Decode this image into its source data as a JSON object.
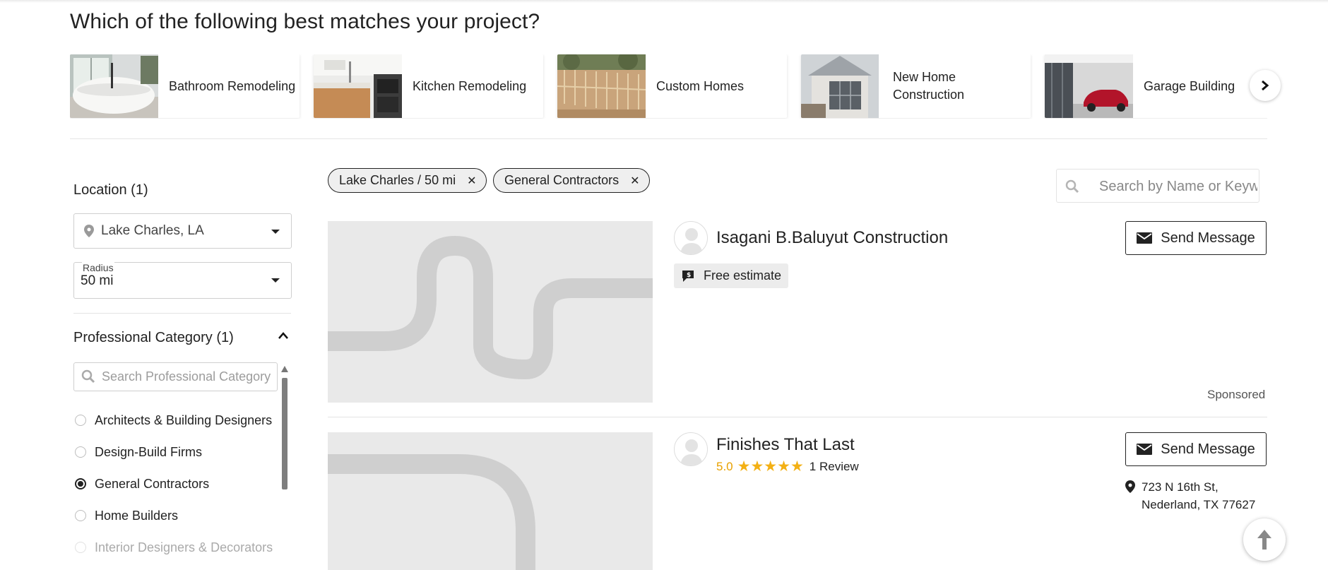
{
  "heading": "Which of the following best matches your project?",
  "categories": [
    {
      "label": "Bathroom Remodeling",
      "icon": "bathroom-photo"
    },
    {
      "label": "Kitchen Remodeling",
      "icon": "kitchen-photo"
    },
    {
      "label": "Custom Homes",
      "icon": "custom-homes-photo"
    },
    {
      "label": "New Home Construction",
      "icon": "new-home-photo"
    },
    {
      "label": "Garage Building",
      "icon": "garage-photo"
    }
  ],
  "filters": {
    "location_title": "Location (1)",
    "location_value": "Lake Charles, LA",
    "radius_label": "Radius",
    "radius_value": "50 mi",
    "category_title": "Professional Category (1)",
    "category_search_placeholder": "Search Professional Category",
    "options": [
      {
        "label": "Architects & Building Designers",
        "selected": false
      },
      {
        "label": "Design-Build Firms",
        "selected": false
      },
      {
        "label": "General Contractors",
        "selected": true
      },
      {
        "label": "Home Builders",
        "selected": false
      },
      {
        "label": "Interior Designers & Decorators",
        "selected": false
      }
    ]
  },
  "chips": [
    {
      "label": "Lake Charles / 50 mi"
    },
    {
      "label": "General Contractors"
    }
  ],
  "search": {
    "placeholder": "Search by Name or Keyword"
  },
  "results": [
    {
      "name": "Isagani B.Baluyut Construction",
      "badge": "Free estimate",
      "send_label": "Send Message",
      "sponsored": "Sponsored"
    },
    {
      "name": "Finishes That Last",
      "rating": "5.0",
      "stars": 5,
      "reviews": "1 Review",
      "send_label": "Send Message",
      "address_line1": "723 N 16th St,",
      "address_line2": "Nederland, TX 77627"
    }
  ],
  "colors": {
    "accent_star": "#f3b014",
    "rating_text": "#e8a100",
    "text": "#222222"
  }
}
